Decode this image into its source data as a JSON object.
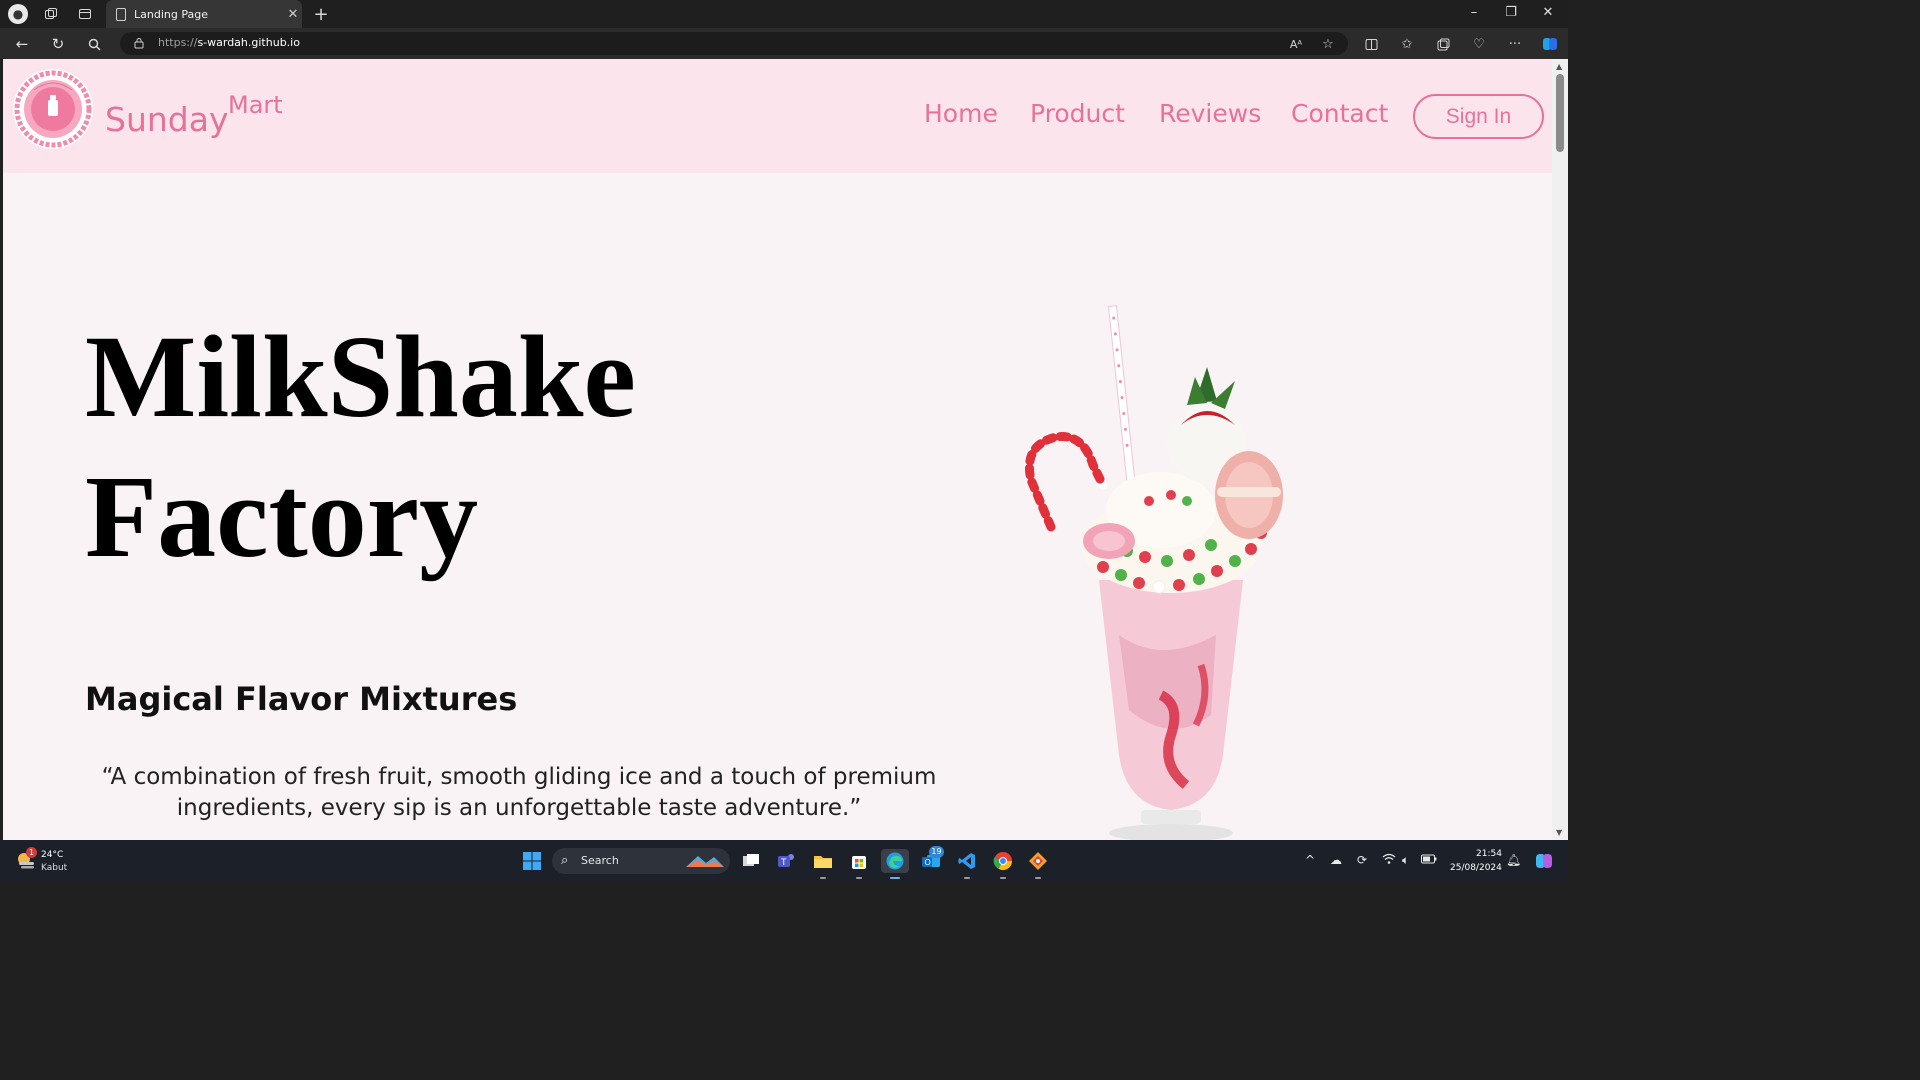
{
  "browser": {
    "tab_title": "Landing Page",
    "url_protocol": "https://",
    "url_host": "s-wardah.github.io"
  },
  "site": {
    "brand_main": "Sunday",
    "brand_sub": "Mart",
    "logo_ring_text": "SUNDAY",
    "logo_bottom_text": "Milkshake Factory",
    "nav": {
      "home": "Home",
      "product": "Product",
      "reviews": "Reviews",
      "contact": "Contact"
    },
    "signin_label": "Sign In",
    "hero_line1": "MilkShake",
    "hero_line2": "Factory",
    "subtitle": "Magical Flavor Mixtures",
    "quote": "“A combination of fresh fruit, smooth gliding ice and a touch of premium ingredients, every sip is an unforgettable taste adventure.”",
    "accent_color": "#e6729a",
    "header_bg": "#fbe4ec",
    "page_bg": "#f9f3f5"
  },
  "taskbar": {
    "temperature": "24°C",
    "condition": "Kabut",
    "weather_badge": "1",
    "search_placeholder": "Search",
    "outlook_badge": "19",
    "time": "21:54",
    "date": "25/08/2024"
  }
}
